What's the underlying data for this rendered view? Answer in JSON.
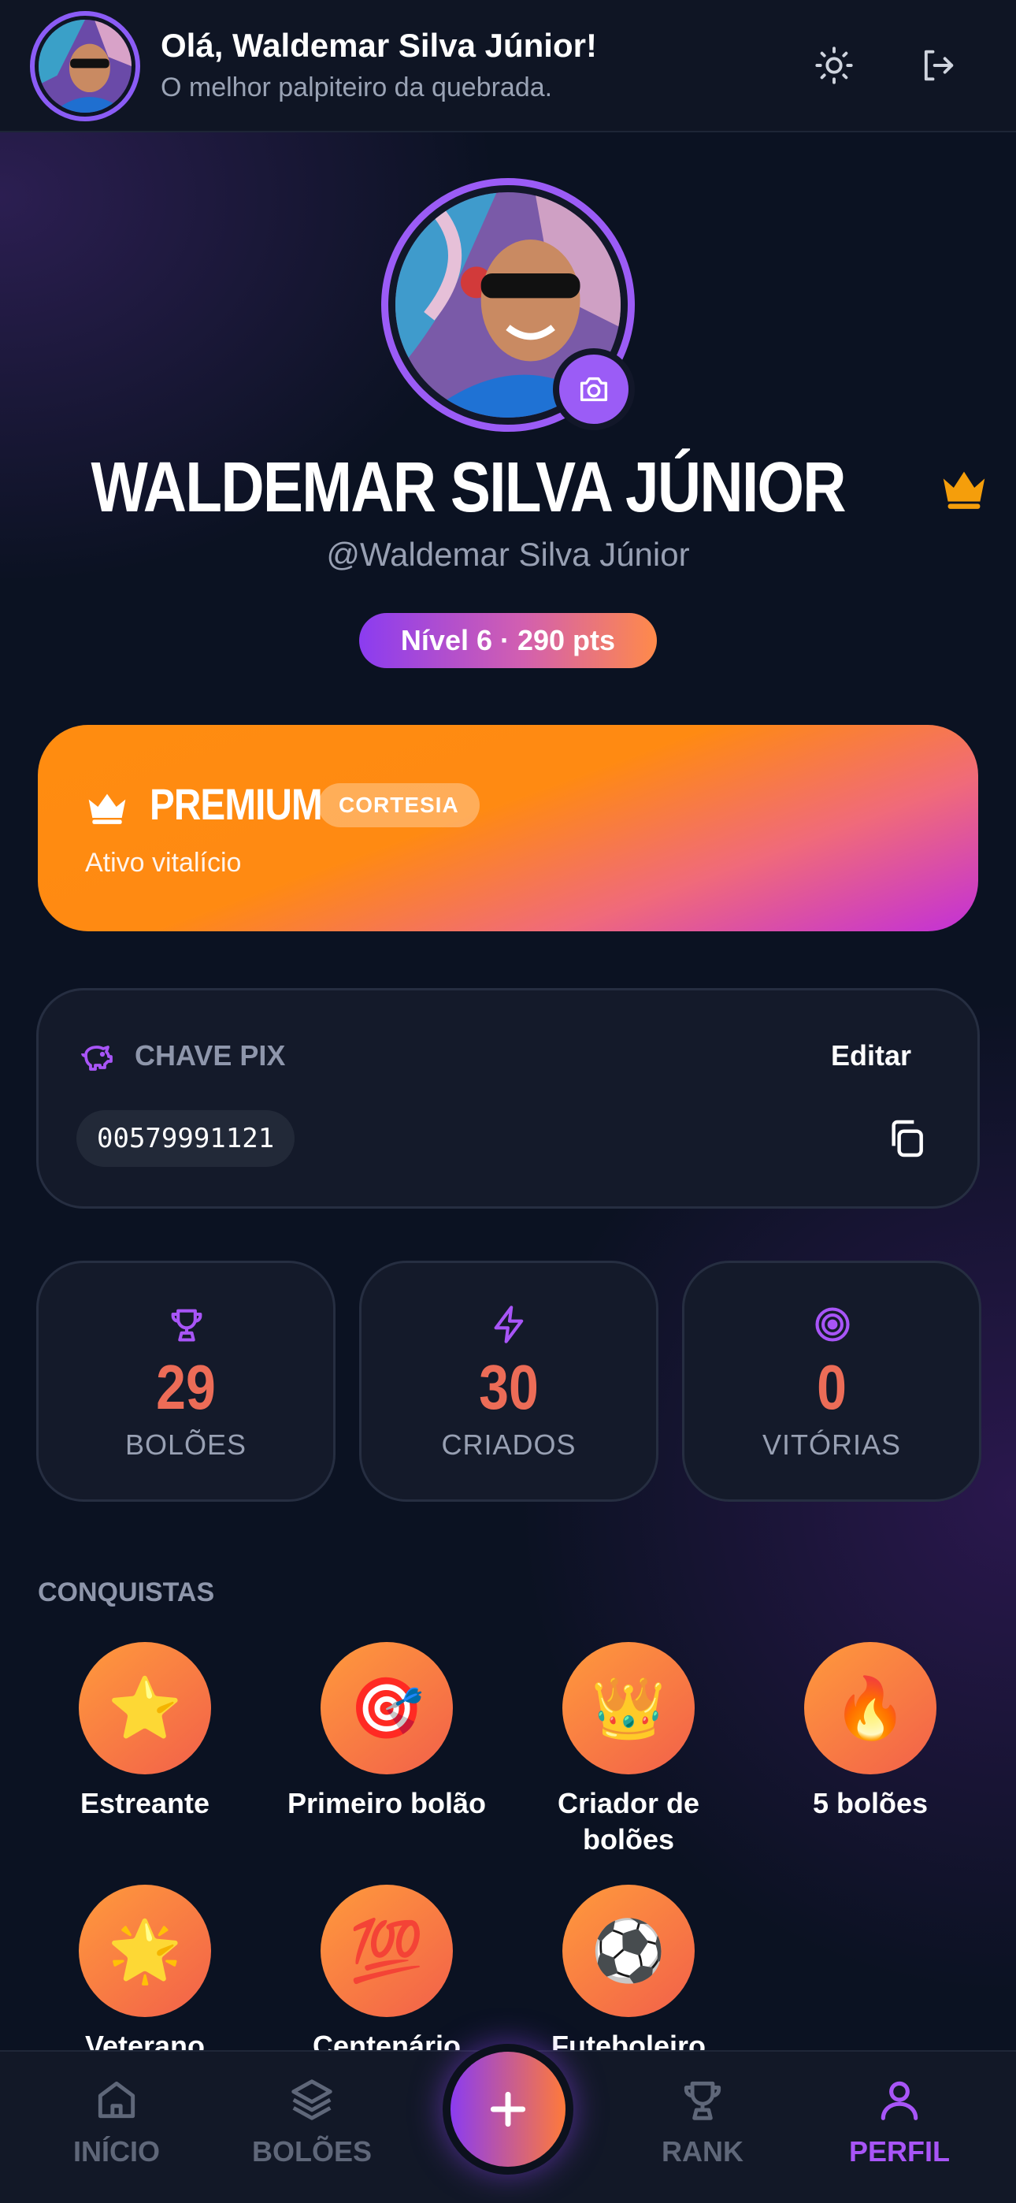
{
  "header": {
    "greeting": "Olá, Waldemar Silva Júnior!",
    "subtitle": "O melhor palpiteiro da quebrada.",
    "theme_icon": "sun-icon",
    "logout_icon": "logout-icon"
  },
  "profile": {
    "name": "WALDEMAR SILVA JÚNIOR",
    "handle": "@Waldemar Silva Júnior",
    "level_badge": "Nível 6 · 290 pts",
    "crown_color": "#f59e0b"
  },
  "premium": {
    "title": "PREMIUM",
    "badge": "CORTESIA",
    "status": "Ativo vitalício"
  },
  "pix": {
    "title": "CHAVE PIX",
    "edit_label": "Editar",
    "key": "00579991121"
  },
  "stats": [
    {
      "icon": "trophy-icon",
      "value": "29",
      "label": "BOLÕES"
    },
    {
      "icon": "lightning-icon",
      "value": "30",
      "label": "CRIADOS"
    },
    {
      "icon": "target-icon",
      "value": "0",
      "label": "VITÓRIAS"
    }
  ],
  "achievements": {
    "title": "CONQUISTAS",
    "items": [
      {
        "emoji": "⭐",
        "label": "Estreante"
      },
      {
        "emoji": "🎯",
        "label": "Primeiro bolão"
      },
      {
        "emoji": "👑",
        "label": "Criador de bolões"
      },
      {
        "emoji": "🔥",
        "label": "5 bolões"
      },
      {
        "emoji": "🌟",
        "label": "Veterano"
      },
      {
        "emoji": "💯",
        "label": "Centenário"
      },
      {
        "emoji": "⚽",
        "label": "Futeboleiro"
      }
    ]
  },
  "nav": {
    "items": [
      {
        "icon": "home-icon",
        "label": "INÍCIO"
      },
      {
        "icon": "layers-icon",
        "label": "BOLÕES"
      },
      {
        "icon": "trophy-icon",
        "label": "RANK"
      },
      {
        "icon": "user-icon",
        "label": "PERFIL"
      }
    ],
    "active": "PERFIL",
    "accent": "#a855f7"
  }
}
